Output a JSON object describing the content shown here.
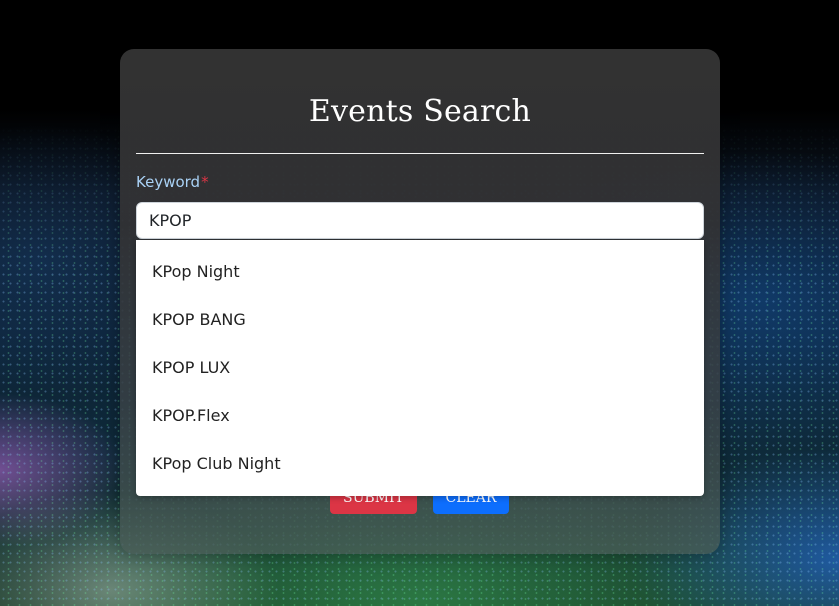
{
  "form": {
    "title": "Events Search",
    "keyword_label": "Keyword",
    "required_mark": "*",
    "keyword_value": "KPOP",
    "submit_label": "SUBMIT",
    "clear_label": "CLEAR"
  },
  "autocomplete": {
    "options": [
      "KPop Night",
      "KPOP BANG",
      "KPOP LUX",
      "KPOP.Flex",
      "KPop Club Night"
    ]
  },
  "colors": {
    "required": "#dc3545",
    "submit": "#dc3545",
    "clear": "#0d6efd",
    "label": "#a9d1f5"
  }
}
